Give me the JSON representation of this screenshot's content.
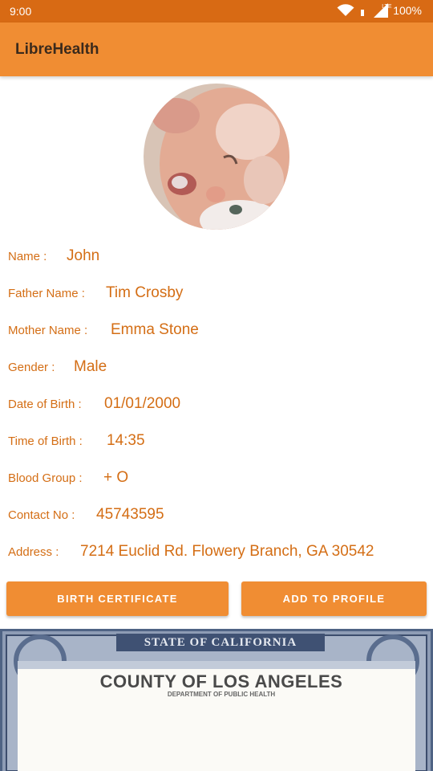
{
  "status_bar": {
    "time": "9:00",
    "network": "LTE",
    "battery": "100%"
  },
  "app_bar": {
    "title": "LibreHealth"
  },
  "profile": {
    "fields": [
      {
        "label": "Name :",
        "value": "John"
      },
      {
        "label": "Father Name :",
        "value": "Tim Crosby"
      },
      {
        "label": "Mother Name :",
        "value": "Emma Stone"
      },
      {
        "label": "Gender :",
        "value": "Male"
      },
      {
        "label": "Date of Birth :",
        "value": "01/01/2000"
      },
      {
        "label": "Time of Birth :",
        "value": "14:35"
      },
      {
        "label": "Blood Group :",
        "value": "+ O"
      },
      {
        "label": "Contact No :",
        "value": "45743595"
      },
      {
        "label": "Address :",
        "value": "7214 Euclid Rd. Flowery Branch, GA 30542"
      }
    ]
  },
  "buttons": {
    "birth_certificate": "BIRTH CERTIFICATE",
    "add_to_profile": "ADD TO PROFILE"
  },
  "certificate": {
    "state": "STATE OF CALIFORNIA",
    "county": "COUNTY OF LOS ANGELES",
    "department": "DEPARTMENT OF PUBLIC HEALTH"
  },
  "colors": {
    "accent": "#f08d33",
    "status_bar": "#d86a14",
    "label_text": "#d46e15"
  }
}
